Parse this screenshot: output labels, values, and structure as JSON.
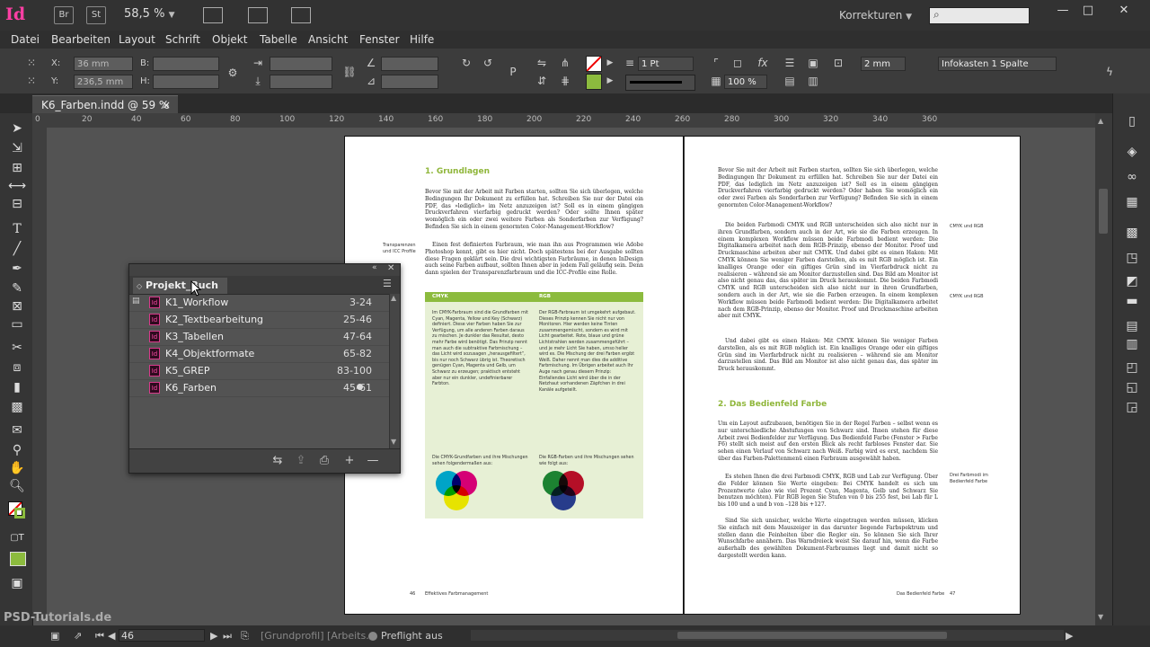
{
  "app": {
    "logo": "Id",
    "bridge_label": "Br",
    "stock_label": "St",
    "zoom": "58,5 %",
    "workspace": "Korrekturen",
    "search_icon": "search-icon"
  },
  "menu": [
    "Datei",
    "Bearbeiten",
    "Layout",
    "Schrift",
    "Objekt",
    "Tabelle",
    "Ansicht",
    "Fenster",
    "Hilfe"
  ],
  "control": {
    "x_label": "X:",
    "x_value": "36 mm",
    "y_label": "Y:",
    "y_value": "236,5 mm",
    "b_label": "B:",
    "h_label": "H:",
    "stroke_weight": "1 Pt",
    "opacity": "100 %",
    "spacing": "2 mm",
    "object_style": "Infokasten 1 Spalte"
  },
  "tab": {
    "title": "K6_Farben.indd @ 59 %",
    "close": "×"
  },
  "ruler": [
    "0",
    "20",
    "40",
    "60",
    "80",
    "100",
    "120",
    "140",
    "160",
    "180",
    "200",
    "220",
    "240",
    "260",
    "280",
    "300",
    "320",
    "340",
    "360"
  ],
  "book_panel": {
    "title": "Projekt_Buch",
    "items": [
      {
        "name": "K1_Workflow",
        "pages": "3-24"
      },
      {
        "name": "K2_Textbearbeitung",
        "pages": "25-46"
      },
      {
        "name": "K3_Tabellen",
        "pages": "47-64"
      },
      {
        "name": "K4_Objektformate",
        "pages": "65-82"
      },
      {
        "name": "K5_GREP",
        "pages": "83-100"
      },
      {
        "name": "K6_Farben",
        "pages": "45-61"
      }
    ]
  },
  "left_page": {
    "heading": "1.  Grundlagen",
    "margin_note": "Transparenzen und ICC Profile",
    "para1": "Bevor Sie mit der Arbeit mit Farben starten, sollten Sie sich überlegen, welche Bedingungen Ihr Dokument zu erfüllen hat. Schreiben Sie nur der Datei ein PDF, das »lediglich« im Netz anzuzeigen ist? Soll es in einem gängigen Druckverfahren vierfarbig gedruckt werden? Oder sollte Ihnen später womöglich ein oder zwei weitere Farben als Sonderfarben zur Verfügung? Befinden Sie sich in einem genormten Color-Management-Workflow?",
    "para2": "Einen fest definierten Farbraum, wie man ihn aus Programmen wie Adobe Photoshop kennt, gibt es hier nicht. Doch spätestens bei der Ausgabe sollten diese Fragen geklärt sein. Die drei wichtigsten Farbräume, in denen InDesign auch seine Farben aufbaut, sollten Ihnen aber in jedem Fall geläufig sein. Denn dann spielen der Transparenzfarbraum und die ICC-Profile eine Rolle.",
    "box_head_left": "CMYK",
    "box_head_right": "RGB",
    "box_left": "Im CMYK-Farbraum sind die Grundfarben mit Cyan, Magenta, Yellow und Key (Schwarz) definiert. Diese vier Farben haben Sie zur Verfügung, um alle anderen Farben daraus zu mischen. Je dunkler das Resultat, desto mehr Farbe wird benötigt. Das Prinzip nennt man auch die subtraktive Farbmischung – das Licht wird sozusagen „herausgefiltert“, bis nur noch Schwarz übrig ist. Theoretisch genügen Cyan, Magenta und Gelb, um Schwarz zu erzeugen; praktisch entsteht aber nur ein dunkler, undefinierbarer Farbton.",
    "box_right": "Der RGB-Farbraum ist umgekehrt aufgebaut. Dieses Prinzip kennen Sie nicht nur von Monitoren. Hier werden keine Tinten zusammengemischt, sondern es wird mit Licht gearbeitet. Rote, blaue und grüne Lichtstrahlen werden zusammengeführt – und je mehr Licht Sie haben, umso heller wird es. Die Mischung der drei Farben ergibt Weiß. Daher nennt man dies die additive Farbmischung. Im Übrigen arbeitet auch Ihr Auge nach genau diesem Prinzip: Einfallendes Licht wird über die in der Netzhaut vorhandenen Zäpfchen in drei Kanäle aufgeteilt.",
    "caption_left": "Die CMYK-Grundfarben und ihre Mischungen sehen folgendermaßen aus:",
    "caption_right": "Die RGB-Farben und ihre Mischungen sehen wie folgt aus:",
    "page_number": "46",
    "footer": "Effektives Farbmanagement"
  },
  "right_page": {
    "para1": "Bevor Sie mit der Arbeit mit Farben starten, sollten Sie sich überlegen, welche Bedingungen Ihr Dokument zu erfüllen hat. Schreiben Sie nur der Datei ein PDF, das lediglich im Netz anzuzeigen ist? Soll es in einem gängigen Druckverfahren vierfarbig gedruckt werden? Oder haben Sie womöglich ein oder zwei Farben als Sonderfarben zur Verfügung? Befinden Sie sich in einem genormten Color-Management-Workflow?",
    "para2": "Die beiden Farbmodi CMYK und RGB unterscheiden sich also nicht nur in ihren Grundfarben, sondern auch in der Art, wie sie die Farben erzeugen. In einem komplexen Workflow müssen beide Farbmodi bedient werden: Die Digitalkamera arbeitet nach dem RGB-Prinzip, ebenso der Monitor. Proof und Druckmaschine arbeiten aber mit CMYK. Und dabei gibt es einen Haken: Mit CMYK können Sie weniger Farben darstellen, als es mit RGB möglich ist. Ein knalliges Orange oder ein giftiges Grün sind im Vierfarbdruck nicht zu realisieren – während sie am Monitor darzustellen sind. Das Bild am Monitor ist also nicht genau das, das später im Druck herauskommt. Die beiden Farbmodi CMYK und RGB unterscheiden sich also nicht nur in ihren Grundfarben, sondern auch in der Art, wie sie die Farben erzeugen. In einem komplexen Workflow müssen beide Farbmodi bedient werden: Die Digitalkamera arbeitet nach dem RGB-Prinzip, ebenso der Monitor. Proof und Druckmaschine arbeiten aber mit CMYK.",
    "para3": "Und dabei gibt es einen Haken: Mit CMYK können Sie weniger Farben darstellen, als es mit RGB möglich ist. Ein knalliges Orange oder ein giftiges Grün sind im Vierfarbdruck nicht zu realisieren – während sie am Monitor darzustellen sind. Das Bild am Monitor ist also nicht genau das, das später im Druck herauskommt.",
    "note1": "CMYK und RGB",
    "note2": "CMYK und RGB",
    "heading": "2.  Das Bedienfeld Farbe",
    "para4": "Um ein Layout aufzubauen, benötigen Sie in der Regel Farben – selbst wenn es nur unterschiedliche Abstufungen von Schwarz sind. Ihnen stehen für diese Arbeit zwei Bedienfelder zur Verfügung. Das Bedienfeld Farbe (Fenster > Farbe F6) stellt sich meist auf den ersten Blick als recht farbloses Fenster dar. Sie sehen einen Verlauf von Schwarz nach Weiß. Farbig wird es erst, nachdem Sie über das Farben-Palettenmenü einen Farbraum ausgewählt haben.",
    "para5": "Es stehen Ihnen die drei Farbmodi CMYK, RGB und Lab zur Verfügung. Über die Felder können Sie Werte eingeben: Bei CMYK handelt es sich um Prozentwerte (also wie viel Prozent Cyan, Magenta, Gelb und Schwarz Sie benutzen möchten). Für RGB legen Sie Stufen von 0 bis 255 fest, bei Lab für L bis 100 und a und b von –128 bis +127.",
    "para6": "Sind Sie sich unsicher, welche Werte eingetragen werden müssen, klicken Sie einfach mit dem Mauszeiger in das darunter liegende Farbspektrum und stellen dann die Feinheiten über die Regler ein. So können Sie sich Ihrer Wunschfarbe annähern. Das Warndreieck weist Sie darauf hin, wenn die Farbe außerhalb des gewählten Dokument-Farbraumes liegt und damit nicht so dargestellt werden kann.",
    "note3": "Drei Farbmodi im Bedienfeld Farbe",
    "page_number": "47",
    "footer": "Das Bedienfeld Farbe"
  },
  "status": {
    "page": "46",
    "profile": "[Grundprofil] [Arbeits...",
    "preflight": "Preflight aus"
  },
  "watermark": "PSD-Tutorials.de",
  "colors": {
    "accent_green": "#8cbb3e",
    "indesign_pink": "#ff3fa4",
    "panel_dark": "#323232"
  }
}
